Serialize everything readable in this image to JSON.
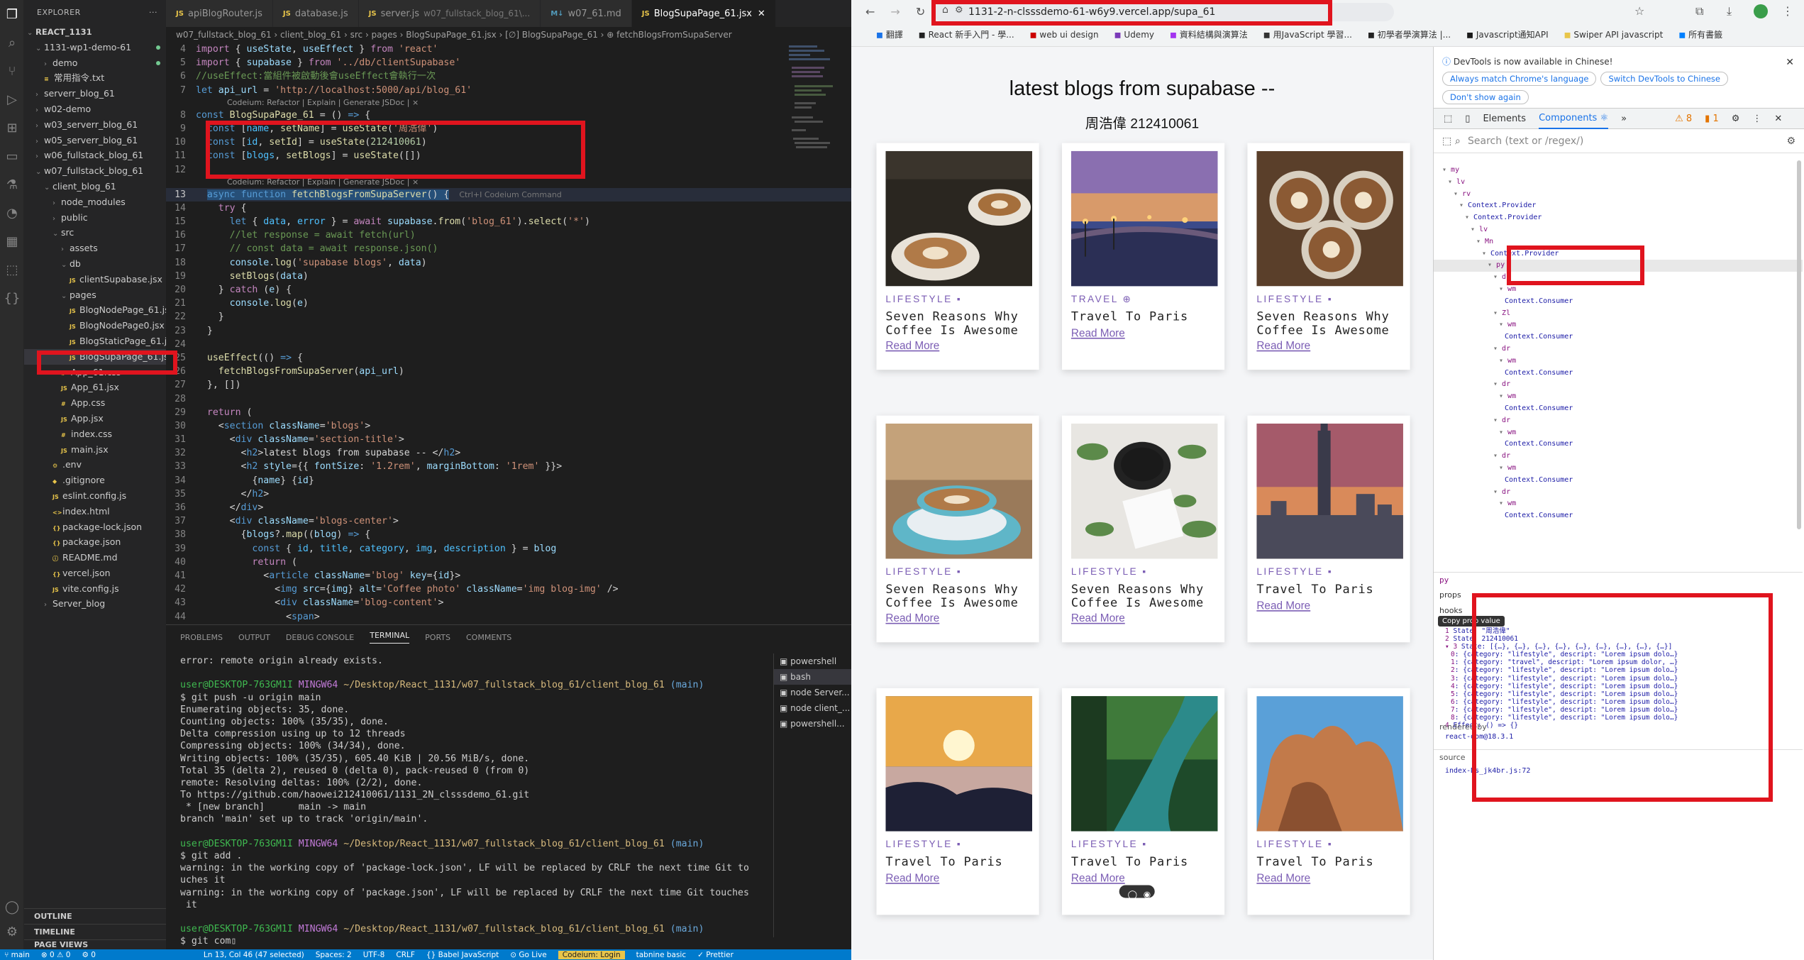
{
  "vscode": {
    "explorer_title": "EXPLORER",
    "tree": [
      {
        "label": "REACT_1131",
        "indent": 0,
        "twisty": "⌄",
        "bold": true
      },
      {
        "label": "1131-wp1-demo-61",
        "indent": 1,
        "twisty": "⌄",
        "dot": true
      },
      {
        "label": "demo",
        "indent": 2,
        "twisty": "›",
        "dot": true
      },
      {
        "label": "常用指令.txt",
        "indent": 2,
        "icon": "≡"
      },
      {
        "label": "serverr_blog_61",
        "indent": 1,
        "twisty": "›"
      },
      {
        "label": "w02-demo",
        "indent": 1,
        "twisty": "›"
      },
      {
        "label": "w03_serverr_blog_61",
        "indent": 1,
        "twisty": "›"
      },
      {
        "label": "w05_serverr_blog_61",
        "indent": 1,
        "twisty": "›"
      },
      {
        "label": "w06_fullstack_blog_61",
        "indent": 1,
        "twisty": "›"
      },
      {
        "label": "w07_fullstack_blog_61",
        "indent": 1,
        "twisty": "⌄"
      },
      {
        "label": "client_blog_61",
        "indent": 2,
        "twisty": "⌄"
      },
      {
        "label": "node_modules",
        "indent": 3,
        "twisty": "›"
      },
      {
        "label": "public",
        "indent": 3,
        "twisty": "›"
      },
      {
        "label": "src",
        "indent": 3,
        "twisty": "⌄"
      },
      {
        "label": "assets",
        "indent": 4,
        "twisty": "›"
      },
      {
        "label": "db",
        "indent": 4,
        "twisty": "⌄"
      },
      {
        "label": "clientSupabase.jsx",
        "indent": 5,
        "icon": "JS"
      },
      {
        "label": "pages",
        "indent": 4,
        "twisty": "⌄"
      },
      {
        "label": "BlogNodePage_61.jsx",
        "indent": 5,
        "icon": "JS"
      },
      {
        "label": "BlogNodePage0.jsx",
        "indent": 5,
        "icon": "JS"
      },
      {
        "label": "BlogStaticPage_61.jsx",
        "indent": 5,
        "icon": "JS"
      },
      {
        "label": "BlogSupaPage_61.jsx",
        "indent": 5,
        "icon": "JS",
        "selected": true
      },
      {
        "label": "App_61.css",
        "indent": 4,
        "icon": "#"
      },
      {
        "label": "App_61.jsx",
        "indent": 4,
        "icon": "JS"
      },
      {
        "label": "App.css",
        "indent": 4,
        "icon": "#"
      },
      {
        "label": "App.jsx",
        "indent": 4,
        "icon": "JS"
      },
      {
        "label": "index.css",
        "indent": 4,
        "icon": "#"
      },
      {
        "label": "main.jsx",
        "indent": 4,
        "icon": "JS"
      },
      {
        "label": ".env",
        "indent": 3,
        "icon": "⚙"
      },
      {
        "label": ".gitignore",
        "indent": 3,
        "icon": "◆"
      },
      {
        "label": "eslint.config.js",
        "indent": 3,
        "icon": "JS"
      },
      {
        "label": "index.html",
        "indent": 3,
        "icon": "<>"
      },
      {
        "label": "package-lock.json",
        "indent": 3,
        "icon": "{}"
      },
      {
        "label": "package.json",
        "indent": 3,
        "icon": "{}"
      },
      {
        "label": "README.md",
        "indent": 3,
        "icon": "ⓘ"
      },
      {
        "label": "vercel.json",
        "indent": 3,
        "icon": "{}"
      },
      {
        "label": "vite.config.js",
        "indent": 3,
        "icon": "JS"
      },
      {
        "label": "Server_blog",
        "indent": 2,
        "twisty": "›"
      }
    ],
    "outline": "OUTLINE",
    "timeline": "TIMELINE",
    "page_views": "PAGE VIEWS",
    "tabs": [
      {
        "label": "apiBlogRouter.js"
      },
      {
        "label": "database.js"
      },
      {
        "label": "server.js",
        "dim": "w07_fullstack_blog_61\\..."
      },
      {
        "label": "w07_61.md",
        "md": true
      },
      {
        "label": "BlogSupaPage_61.jsx",
        "active": true
      }
    ],
    "breadcrumb": "w07_fullstack_blog_61 › client_blog_61 › src › pages › BlogSupaPage_61.jsx › [∅] BlogSupaPage_61 › ⊕ fetchBlogsFromSupaServer",
    "codelens1": "Codeium: Refactor | Explain | Generate JSDoc | ×",
    "codelens2": "Codeium: Refactor | Explain | Generate JSDoc | ×",
    "ghost": "Ctrl+I Codeium Command",
    "panel_tabs": [
      "PROBLEMS",
      "OUTPUT",
      "DEBUG CONSOLE",
      "TERMINAL",
      "PORTS",
      "COMMENTS"
    ],
    "terminals": [
      "powershell",
      "bash",
      "node Server...",
      "node client_...",
      "powershell..."
    ],
    "terminal_lines": [
      {
        "t": "error: remote origin already exists."
      },
      {
        "t": ""
      },
      {
        "prompt": true,
        "user": "user@DESKTOP-763GM1I",
        "env": "MINGW64",
        "path": "~/Desktop/React_1131/w07_fullstack_blog_61/client_blog_61",
        "branch": "(main)"
      },
      {
        "t": "$ git push -u origin main"
      },
      {
        "t": "Enumerating objects: 35, done."
      },
      {
        "t": "Counting objects: 100% (35/35), done."
      },
      {
        "t": "Delta compression using up to 12 threads"
      },
      {
        "t": "Compressing objects: 100% (34/34), done."
      },
      {
        "t": "Writing objects: 100% (35/35), 605.40 KiB | 20.56 MiB/s, done."
      },
      {
        "t": "Total 35 (delta 2), reused 0 (delta 0), pack-reused 0 (from 0)"
      },
      {
        "t": "remote: Resolving deltas: 100% (2/2), done."
      },
      {
        "t": "To https://github.com/haowei212410061/1131_2N_clsssdemo_61.git"
      },
      {
        "t": " * [new branch]      main -> main"
      },
      {
        "t": "branch 'main' set up to track 'origin/main'."
      },
      {
        "t": ""
      },
      {
        "prompt": true,
        "user": "user@DESKTOP-763GM1I",
        "env": "MINGW64",
        "path": "~/Desktop/React_1131/w07_fullstack_blog_61/client_blog_61",
        "branch": "(main)"
      },
      {
        "t": "$ git add ."
      },
      {
        "t": "warning: in the working copy of 'package-lock.json', LF will be replaced by CRLF the next time Git to"
      },
      {
        "t": "uches it"
      },
      {
        "t": "warning: in the working copy of 'package.json', LF will be replaced by CRLF the next time Git touches"
      },
      {
        "t": " it"
      },
      {
        "t": ""
      },
      {
        "prompt": true,
        "user": "user@DESKTOP-763GM1I",
        "env": "MINGW64",
        "path": "~/Desktop/React_1131/w07_fullstack_blog_61/client_blog_61",
        "branch": "(main)"
      },
      {
        "t": "$ git com▯"
      }
    ],
    "status": [
      "⑂ main",
      "⊗ 0 ⚠ 0",
      "⚙ 0",
      "Ln 13, Col 46 (47 selected)",
      "Spaces: 2",
      "UTF-8",
      "CRLF",
      "{} Babel JavaScript",
      "⊙ Go Live",
      "Codeium: Login",
      "tabnine basic",
      "✓ Prettier"
    ]
  },
  "browser": {
    "url": "1131-2-n-clsssdemo-61-w6y9.vercel.app/supa_61",
    "bookmarks": [
      "翻譯",
      "React 新手入門 - 學...",
      "web ui design",
      "Udemy",
      "資料結構與演算法",
      "用JavaScript 學習...",
      "初學者學演算法 |...",
      "Javascript通知API",
      "Swiper API javascript",
      "所有書籤"
    ],
    "heading": "latest blogs from supabase --",
    "sub": "周浩偉 212410061",
    "read_more": "Read More",
    "cards": [
      {
        "cat": "LIFESTYLE",
        "title": "Seven Reasons Why Coffee Is Awesome",
        "img": "coffee"
      },
      {
        "cat": "TRAVEL",
        "title": "Travel To Paris",
        "img": "paris"
      },
      {
        "cat": "LIFESTYLE",
        "title": "Seven Reasons Why Coffee Is Awesome",
        "img": "coffee2"
      },
      {
        "cat": "LIFESTYLE",
        "title": "Seven Reasons Why Coffee Is Awesome",
        "img": "cup"
      },
      {
        "cat": "LIFESTYLE",
        "title": "Seven Reasons Why Coffee Is Awesome",
        "img": "cup2"
      },
      {
        "cat": "LIFESTYLE",
        "title": "Travel To Paris",
        "img": "taipei"
      },
      {
        "cat": "LIFESTYLE",
        "title": "Travel To Paris",
        "img": "sunrise"
      },
      {
        "cat": "LIFESTYLE",
        "title": "Travel To Paris",
        "img": "river"
      },
      {
        "cat": "LIFESTYLE",
        "title": "Travel To Paris",
        "img": "rocks"
      }
    ]
  },
  "devtools": {
    "notice": "DevTools is now available in Chinese!",
    "btn1": "Always match Chrome's language",
    "btn2": "Switch DevTools to Chinese",
    "btn3": "Don't show again",
    "tabs": [
      "Elements",
      "Components ⚛"
    ],
    "warn_count": "8",
    "info_count": "1",
    "search_placeholder": "Search (text or /regex/)",
    "tree": [
      {
        "n": "my",
        "d": 0
      },
      {
        "n": "lv",
        "d": 1
      },
      {
        "n": "rv",
        "d": 2
      },
      {
        "n": "Context.Provider",
        "d": 3
      },
      {
        "n": "Context.Provider",
        "d": 4
      },
      {
        "n": "lv",
        "d": 5
      },
      {
        "n": "Mn",
        "d": 6
      },
      {
        "n": "Context.Provider",
        "d": 7
      },
      {
        "n": "py",
        "d": 8,
        "sel": true
      },
      {
        "n": "dr",
        "d": 9
      },
      {
        "n": "wm",
        "d": 10
      },
      {
        "n": "Context.Consumer",
        "d": 11
      },
      {
        "n": "Zl",
        "d": 9
      },
      {
        "n": "wm",
        "d": 10
      },
      {
        "n": "Context.Consumer",
        "d": 11
      },
      {
        "n": "dr",
        "d": 9
      },
      {
        "n": "wm",
        "d": 10
      },
      {
        "n": "Context.Consumer",
        "d": 11
      },
      {
        "n": "dr",
        "d": 9
      },
      {
        "n": "wm",
        "d": 10
      },
      {
        "n": "Context.Consumer",
        "d": 11
      },
      {
        "n": "dr",
        "d": 9
      },
      {
        "n": "wm",
        "d": 10
      },
      {
        "n": "Context.Consumer",
        "d": 11
      },
      {
        "n": "dr",
        "d": 9
      },
      {
        "n": "wm",
        "d": 10
      },
      {
        "n": "Context.Consumer",
        "d": 11
      },
      {
        "n": "dr",
        "d": 9
      },
      {
        "n": "wm",
        "d": 10
      },
      {
        "n": "Context.Consumer",
        "d": 11
      }
    ],
    "selected": "py",
    "props": "props",
    "hooks": "hooks",
    "tooltip": "Copy prop value",
    "hook_state1": "State: \"周浩偉\"",
    "hook_state2": "State: 212410061",
    "hook_state3": "State: [{…}, {…}, {…}, {…}, {…}, {…}, {…}, {…}, {…}]",
    "hook_items": [
      {
        "i": "0",
        "v": "{category: \"lifestyle\", descript: \"Lorem ipsum dolo…}"
      },
      {
        "i": "1",
        "v": "{category: \"travel\", descript: \"Lorem ipsum dolor, …}"
      },
      {
        "i": "2",
        "v": "{category: \"lifestyle\", descript: \"Lorem ipsum dolo…}"
      },
      {
        "i": "3",
        "v": "{category: \"lifestyle\", descript: \"Lorem ipsum dolo…}"
      },
      {
        "i": "4",
        "v": "{category: \"lifestyle\", descript: \"Lorem ipsum dolo…}"
      },
      {
        "i": "5",
        "v": "{category: \"lifestyle\", descript: \"Lorem ipsum dolo…}"
      },
      {
        "i": "6",
        "v": "{category: \"lifestyle\", descript: \"Lorem ipsum dolo…}"
      },
      {
        "i": "7",
        "v": "{category: \"lifestyle\", descript: \"Lorem ipsum dolo…}"
      },
      {
        "i": "8",
        "v": "{category: \"lifestyle\", descript: \"Lorem ipsum dolo…}"
      }
    ],
    "effect": "Effect: () => {}",
    "rendered_by": "rendered by",
    "react_dom": "react-dom@18.3.1",
    "source": "source",
    "source_file": "index-Ds_jk4br.js:72"
  }
}
